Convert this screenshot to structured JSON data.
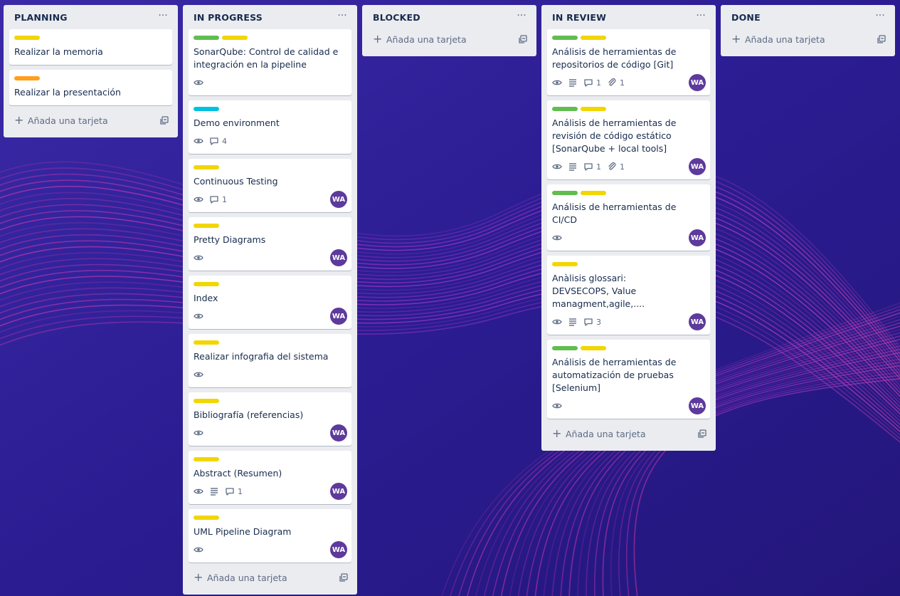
{
  "colors": {
    "green": "#61bd4f",
    "yellow": "#f2d600",
    "orange": "#ff9f1a",
    "teal": "#00c2e0",
    "avatar": "#5d3a9b"
  },
  "add_card_label": "Añada una tarjeta",
  "list_menu_glyph": "···",
  "lists": [
    {
      "title": "PLANNING",
      "cards": [
        {
          "labels": [
            "yellow"
          ],
          "title": "Realizar la memoria"
        },
        {
          "labels": [
            "orange"
          ],
          "title": "Realizar la presentación"
        }
      ]
    },
    {
      "title": "IN PROGRESS",
      "cards": [
        {
          "labels": [
            "green",
            "yellow"
          ],
          "title": "SonarQube: Control de calidad e integración en la pipeline",
          "badges": [
            {
              "icon": "eye-icon"
            }
          ]
        },
        {
          "labels": [
            "teal"
          ],
          "title": "Demo environment",
          "badges": [
            {
              "icon": "eye-icon"
            },
            {
              "icon": "comment-icon",
              "count": "4"
            }
          ]
        },
        {
          "labels": [
            "yellow"
          ],
          "title": "Continuous Testing",
          "badges": [
            {
              "icon": "eye-icon"
            },
            {
              "icon": "comment-icon",
              "count": "1"
            }
          ],
          "member": "WA"
        },
        {
          "labels": [
            "yellow"
          ],
          "title": "Pretty Diagrams",
          "badges": [
            {
              "icon": "eye-icon"
            }
          ],
          "member": "WA"
        },
        {
          "labels": [
            "yellow"
          ],
          "title": "Index",
          "badges": [
            {
              "icon": "eye-icon"
            }
          ],
          "member": "WA"
        },
        {
          "labels": [
            "yellow"
          ],
          "title": "Realizar infografia del sistema",
          "badges": [
            {
              "icon": "eye-icon"
            }
          ]
        },
        {
          "labels": [
            "yellow"
          ],
          "title": "Bibliografía (referencias)",
          "badges": [
            {
              "icon": "eye-icon"
            }
          ],
          "member": "WA"
        },
        {
          "labels": [
            "yellow"
          ],
          "title": "Abstract (Resumen)",
          "badges": [
            {
              "icon": "eye-icon"
            },
            {
              "icon": "description-icon"
            },
            {
              "icon": "comment-icon",
              "count": "1"
            }
          ],
          "member": "WA"
        },
        {
          "labels": [
            "yellow"
          ],
          "title": "UML Pipeline Diagram",
          "badges": [
            {
              "icon": "eye-icon"
            }
          ],
          "member": "WA"
        }
      ]
    },
    {
      "title": "BLOCKED",
      "cards": []
    },
    {
      "title": "IN REVIEW",
      "cards": [
        {
          "labels": [
            "green",
            "yellow"
          ],
          "title": "Análisis de herramientas de repositorios de código [Git]",
          "badges": [
            {
              "icon": "eye-icon"
            },
            {
              "icon": "description-icon"
            },
            {
              "icon": "comment-icon",
              "count": "1"
            },
            {
              "icon": "attachment-icon",
              "count": "1"
            }
          ],
          "member": "WA"
        },
        {
          "labels": [
            "green",
            "yellow"
          ],
          "title": "Análisis de herramientas de revisión de código estático [SonarQube + local tools]",
          "badges": [
            {
              "icon": "eye-icon"
            },
            {
              "icon": "description-icon"
            },
            {
              "icon": "comment-icon",
              "count": "1"
            },
            {
              "icon": "attachment-icon",
              "count": "1"
            }
          ],
          "member": "WA"
        },
        {
          "labels": [
            "green",
            "yellow"
          ],
          "title": "Análisis de herramientas de CI/CD",
          "badges": [
            {
              "icon": "eye-icon"
            }
          ],
          "member": "WA"
        },
        {
          "labels": [
            "yellow"
          ],
          "title": "Anàlisis glossari: DEVSECOPS, Value managment,agile,....",
          "badges": [
            {
              "icon": "eye-icon"
            },
            {
              "icon": "description-icon"
            },
            {
              "icon": "comment-icon",
              "count": "3"
            }
          ],
          "member": "WA"
        },
        {
          "labels": [
            "green",
            "yellow"
          ],
          "title": "Análisis de herramientas de automatización de pruebas [Selenium]",
          "badges": [
            {
              "icon": "eye-icon"
            }
          ],
          "member": "WA"
        }
      ]
    },
    {
      "title": "DONE",
      "cards": []
    }
  ]
}
